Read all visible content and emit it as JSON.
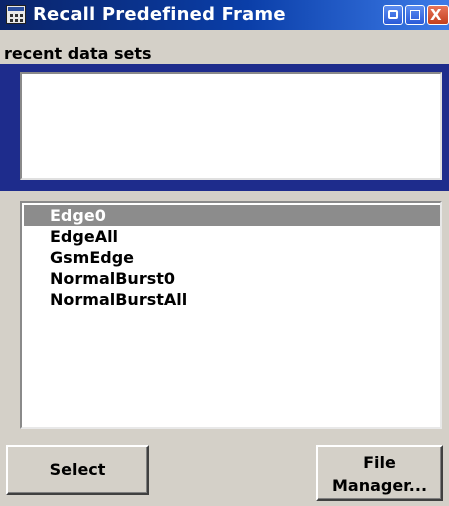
{
  "window": {
    "title": "Recall Predefined Frame",
    "icon": "app-window-icon",
    "controls": {
      "minimize_icon": "minimize-icon",
      "maximize_icon": "maximize-icon",
      "close_icon": "close-icon",
      "close_glyph": "X"
    }
  },
  "recent": {
    "label": "recent data sets",
    "items": []
  },
  "file_list": {
    "items": [
      {
        "label": "Edge0",
        "selected": true
      },
      {
        "label": "EdgeAll",
        "selected": false
      },
      {
        "label": "GsmEdge",
        "selected": false
      },
      {
        "label": "NormalBurst0",
        "selected": false
      },
      {
        "label": "NormalBurstAll",
        "selected": false
      }
    ]
  },
  "buttons": {
    "select_label": "Select",
    "file_manager_line1": "File",
    "file_manager_line2": "Manager..."
  },
  "colors": {
    "title_bar": "#0a246a",
    "recent_frame": "#1e2c8c",
    "selection": "#8c8c8c",
    "dialog_background": "#d4d0c8"
  }
}
